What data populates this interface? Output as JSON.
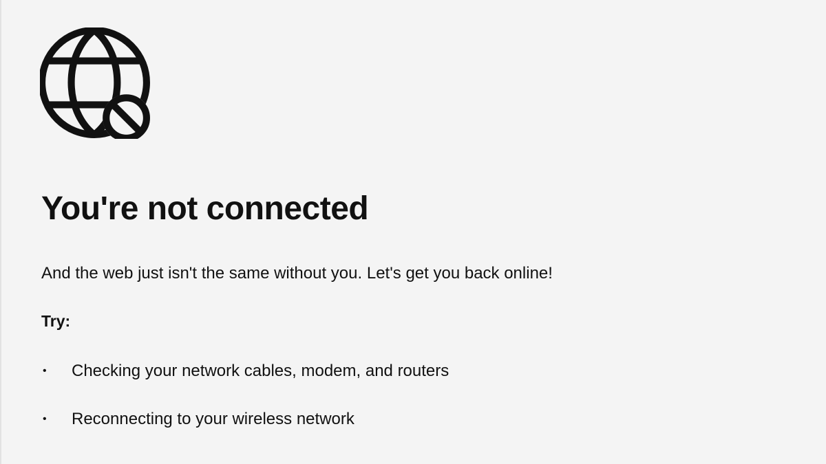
{
  "error_page": {
    "icon": "globe-blocked-icon",
    "title": "You're not connected",
    "message": "And the web just isn't the same without you. Let's get you back online!",
    "try_label": "Try:",
    "suggestions": [
      {
        "bullet": "•",
        "text": "Checking your network cables, modem, and routers"
      },
      {
        "bullet": "•",
        "text": "Reconnecting to your wireless network"
      }
    ]
  },
  "colors": {
    "background": "#f4f4f4",
    "text": "#111111",
    "icon": "#111111"
  }
}
